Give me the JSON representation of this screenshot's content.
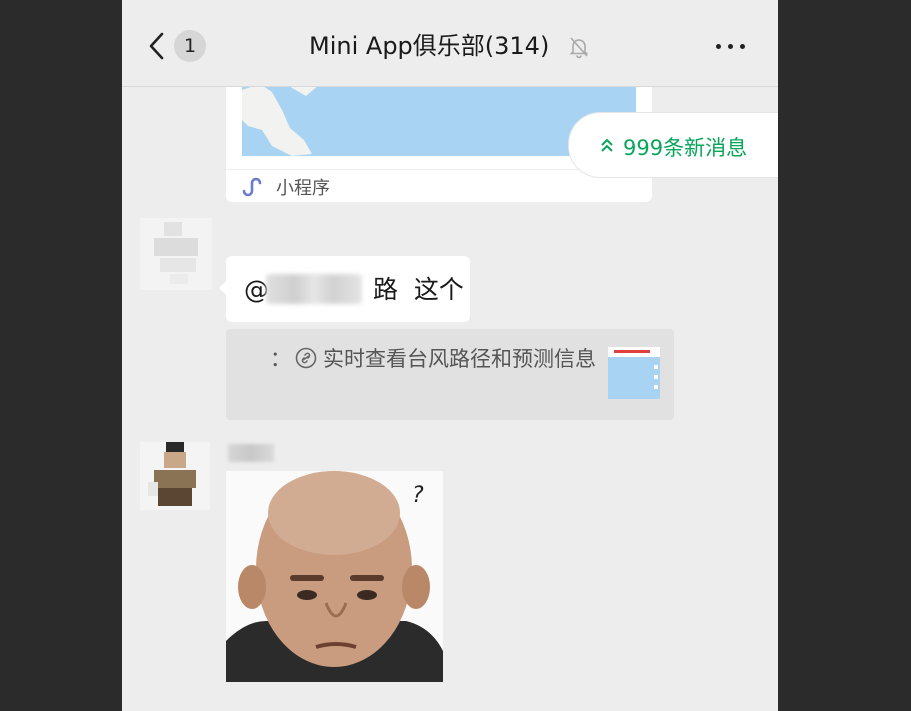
{
  "header": {
    "unread_count": "1",
    "title": "Mini App俱乐部(314)",
    "icons": {
      "back": "chevron-left-icon",
      "mute": "bell-off-icon",
      "more": "more-dots-icon"
    }
  },
  "new_messages": {
    "label": "999条新消息",
    "icon": "double-chevron-up-icon",
    "color": "#07a65b"
  },
  "messages": [
    {
      "type": "mini-program-card",
      "footer_label": "小程序",
      "icon": "mini-program-icon"
    },
    {
      "type": "text",
      "prefix": "@",
      "suffix": "路  这个"
    },
    {
      "type": "quote",
      "colon": "：",
      "text": "实时查看台风路径和预测信息",
      "icon": "link-icon"
    },
    {
      "type": "sticker",
      "overlay": "?"
    }
  ],
  "colors": {
    "background": "#ededed",
    "bubble": "#ffffff",
    "quote": "#e1e1e1",
    "map": "#a9d3f2"
  }
}
